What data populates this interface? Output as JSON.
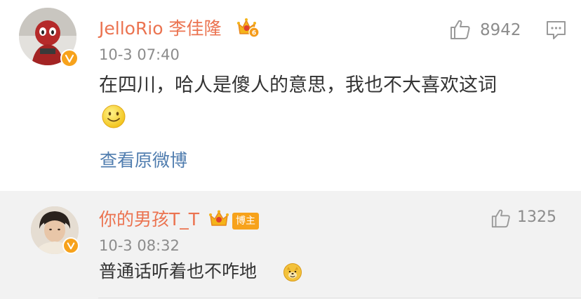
{
  "comment1": {
    "username": "JelloRio 李佳隆",
    "timestamp": "10-3 07:40",
    "text": "在四川，哈人是傻人的意思，我也不大喜欢这词",
    "emoji": "smile-emoji",
    "link_text": "查看原微博",
    "like_count": "8942",
    "crown_badge_level": "6"
  },
  "comment2": {
    "username": "你的男孩T_T",
    "host_badge": "博主",
    "timestamp": "10-3 08:32",
    "text": "普通话听着也不咋地",
    "emoji": "doge-emoji",
    "like_count": "1325"
  },
  "colors": {
    "username": "#eb7350",
    "link": "#507daf",
    "meta": "#8c8c8c",
    "text": "#333333",
    "badge": "#f7a21b",
    "reply_bg": "#f2f2f2"
  }
}
